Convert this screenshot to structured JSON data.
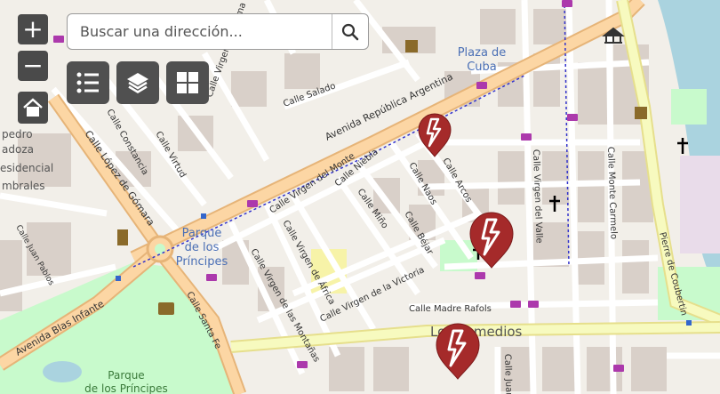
{
  "controls": {
    "zoom_in_label": "+",
    "zoom_out_label": "−",
    "search_placeholder": "Buscar una dirección..."
  },
  "map": {
    "streets": {
      "avenida_republica_argentina": "Avenida República Argentina",
      "calle_lopez_de_gomara": "Calle López de Gómara",
      "calle_virgen_del_monte": "Calle Virgen del Monte",
      "calle_salado": "Calle Salado",
      "calle_constancia": "Calle Constancia",
      "calle_virtud": "Calle Virtud",
      "calle_virgen_de_fatima": "Calle Virgen de Fátima",
      "calle_niebla": "Calle Niebla",
      "calle_mino": "Calle Miño",
      "calle_naos": "Calle Naos",
      "calle_arcos": "Calle Arcos",
      "calle_bejar": "Calle Béjar",
      "calle_virgen_de_africa": "Calle Virgen de África",
      "calle_virgen_de_las_montanas": "Calle Virgen de las Montañas",
      "calle_virgen_de_la_victoria": "Calle Virgen de la Victoria",
      "calle_virgen_del_valle": "Calle Virgen del Valle",
      "calle_monte_carmelo": "Calle Monte Carmelo",
      "calle_madre_rafols": "Calle Madre Rafols",
      "calle_santa_fe": "Calle Santa Fe",
      "avenida_blas_infante": "Avenida Blas Infante",
      "calle_juan_pablos": "Calle Juan Pablos",
      "calle_pierre_de_coubertin": "Pierre de Coubertin",
      "calle_juan_bottom": "Calle Juan"
    },
    "places": {
      "plaza_de_cuba_1": "Plaza de",
      "plaza_de_cuba_2": "Cuba",
      "parque_principes_1": "Parque",
      "parque_principes_2": "de los",
      "parque_principes_3": "Príncipes",
      "parque_principes_park_1": "Parque",
      "parque_principes_park_2": "de los Príncipes",
      "los_remedios": "Los Remedios",
      "left_edge_1": "pedro",
      "left_edge_2": "adoza",
      "left_edge_3": "esidencial",
      "left_edge_4": "mbrales"
    },
    "markers": [
      {
        "name": "charging-marker-1"
      },
      {
        "name": "charging-marker-2"
      },
      {
        "name": "charging-marker-3"
      }
    ],
    "marker_color": "#a52a2a"
  }
}
